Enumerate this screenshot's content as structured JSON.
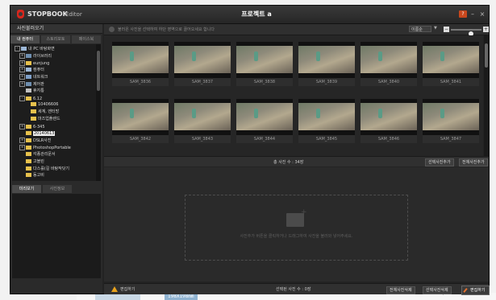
{
  "app": {
    "logo": "STOPBOOK",
    "name": "Editor",
    "project_title": "프로젝트 a"
  },
  "window_buttons": {
    "help": "?",
    "minimize": "–",
    "close": "×"
  },
  "left_panel": {
    "header": "사진불러오기",
    "tabs": [
      "내 컴퓨터",
      "스토리포토",
      "페이스북"
    ],
    "tree": [
      {
        "label": "내 PC 바탕화면",
        "indent": 0,
        "exp": "-",
        "type": "pc"
      },
      {
        "label": "라이브러리",
        "indent": 1,
        "exp": "+",
        "type": "blue"
      },
      {
        "label": "eunjung",
        "indent": 1,
        "exp": "+",
        "type": "folder"
      },
      {
        "label": "컴퓨터",
        "indent": 1,
        "exp": "+",
        "type": "pc"
      },
      {
        "label": "네트워크",
        "indent": 1,
        "exp": "+",
        "type": "net"
      },
      {
        "label": "제어판",
        "indent": 1,
        "exp": "+",
        "type": "blue"
      },
      {
        "label": "휴지통",
        "indent": 1,
        "exp": "",
        "type": "dsk"
      },
      {
        "label": "6.12",
        "indent": 1,
        "exp": "-",
        "type": "folder"
      },
      {
        "label": "10406606",
        "indent": 2,
        "exp": "",
        "type": "folder"
      },
      {
        "label": "세계, 엔터망",
        "indent": 2,
        "exp": "",
        "type": "folder"
      },
      {
        "label": "마즈업플렌드",
        "indent": 2,
        "exp": "",
        "type": "folder"
      },
      {
        "label": "6-345",
        "indent": 1,
        "exp": "+",
        "type": "folder"
      },
      {
        "label": "20140613",
        "indent": 1,
        "exp": "",
        "type": "folder",
        "selected": true
      },
      {
        "label": "DSLR사진",
        "indent": 1,
        "exp": "+",
        "type": "folder"
      },
      {
        "label": "PhotoshopPortable",
        "indent": 1,
        "exp": "+",
        "type": "folder"
      },
      {
        "label": "각종관리문서",
        "indent": 1,
        "exp": "",
        "type": "folder"
      },
      {
        "label": "고블린",
        "indent": 1,
        "exp": "",
        "type": "folder"
      },
      {
        "label": "다스를(길 바탕작닷기",
        "indent": 1,
        "exp": "",
        "type": "folder"
      },
      {
        "label": "동고비",
        "indent": 1,
        "exp": "",
        "type": "folder"
      }
    ],
    "bottom_tabs": [
      "미리보기",
      "사진정보"
    ]
  },
  "main": {
    "info_text": "불러온 사진을 선택하여 하단 영역으로 끌어오세요 합니다",
    "sort": {
      "selected": "이름순"
    },
    "zoom_level": 0.7,
    "thumbnails": [
      "SAM_3836",
      "SAM_3837",
      "SAM_3838",
      "SAM_3839",
      "SAM_3840",
      "SAM_3841",
      "SAM_3842",
      "SAM_3843",
      "SAM_3844",
      "SAM_3845",
      "SAM_3846",
      "SAM_3847"
    ],
    "total_label": "총 사진 수 : 34장",
    "add_selected": "선택사진추가",
    "add_all": "전체사진추가",
    "drop_text": "사진추가 버튼을 클릭하거나 드래그하여 사진을 불러와 넣어주세요.",
    "warning": "편집하기",
    "selected_count": "선택된 사진 수 : 0장",
    "delete_all": "전체사진삭제",
    "delete_selected": "선택사진삭제",
    "edit_button": "편집하기"
  },
  "background": {
    "label": "198X198mm",
    "right_text": "1/1 >"
  }
}
